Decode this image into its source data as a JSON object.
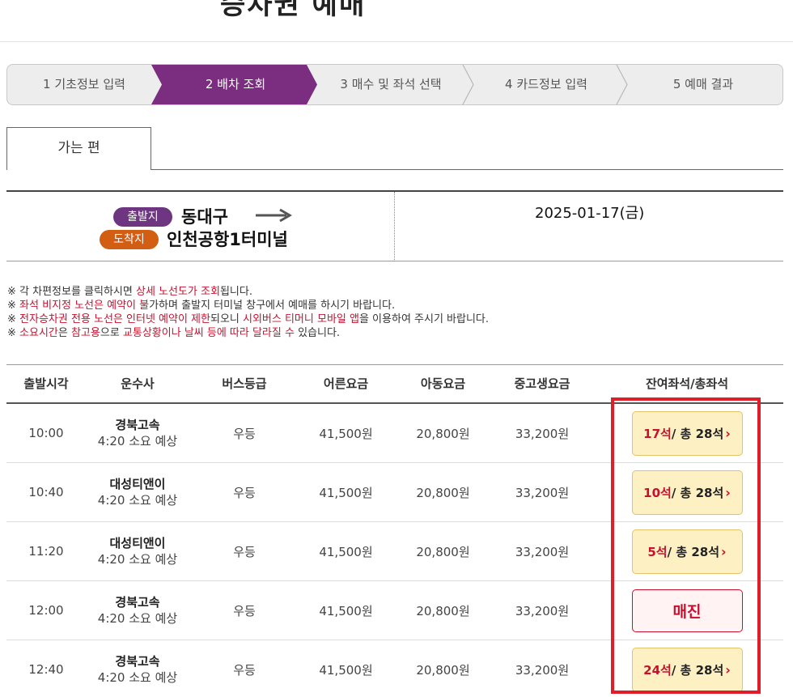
{
  "page": {
    "title": "승차권 예매"
  },
  "steps": [
    {
      "label": "1 기초정보 입력",
      "active": false
    },
    {
      "label": "2 배차 조회",
      "active": true
    },
    {
      "label": "3 매수 및 좌석 선택",
      "active": false
    },
    {
      "label": "4 카드정보 입력",
      "active": false
    },
    {
      "label": "5 예매 결과",
      "active": false
    }
  ],
  "tab": {
    "label": "가는 편"
  },
  "route": {
    "departure_badge": "출발지",
    "departure": "동대구",
    "arrival_badge": "도착지",
    "arrival": "인천공항1터미널",
    "date": "2025-01-17(금)"
  },
  "notices": [
    [
      {
        "t": "※ 각 차편정보를 클릭하시면 "
      },
      {
        "t": "상세 노선도가 조회",
        "hl": true
      },
      {
        "t": "됩니다."
      }
    ],
    [
      {
        "t": "※ "
      },
      {
        "t": "좌석 비지정 노선은 예약이 불",
        "hl": true
      },
      {
        "t": "가하며 출발지 터미널 창구에서 예매를 하시기 바랍니다."
      }
    ],
    [
      {
        "t": "※ "
      },
      {
        "t": "전자승차권 전용 노선은 인터넷 예약이 제한",
        "hl": true
      },
      {
        "t": "되오니 "
      },
      {
        "t": "시외버스 티머니 모바일 앱",
        "hl": true
      },
      {
        "t": "을 이용하여 주시기 바랍니다."
      }
    ],
    [
      {
        "t": "※ "
      },
      {
        "t": "소요시간",
        "hl": true
      },
      {
        "t": "은 "
      },
      {
        "t": "참고용",
        "hl": true
      },
      {
        "t": "으로 "
      },
      {
        "t": "교통상황이나 날씨 등에 따라 달라질 수",
        "hl": true
      },
      {
        "t": " 있습니다."
      }
    ]
  ],
  "table": {
    "headers": [
      "출발시각",
      "운수사",
      "버스등급",
      "어른요금",
      "아동요금",
      "중고생요금",
      "잔여좌석/총좌석"
    ],
    "rows": [
      {
        "time": "10:00",
        "company": "경북고속",
        "duration": "4:20 소요 예상",
        "grade": "우등",
        "adult": "41,500원",
        "child": "20,800원",
        "youth": "33,200원",
        "remaining": "17석",
        "total": " / 총 28석",
        "soldout": false
      },
      {
        "time": "10:40",
        "company": "대성티앤이",
        "duration": "4:20 소요 예상",
        "grade": "우등",
        "adult": "41,500원",
        "child": "20,800원",
        "youth": "33,200원",
        "remaining": "10석",
        "total": " / 총 28석",
        "soldout": false
      },
      {
        "time": "11:20",
        "company": "대성티앤이",
        "duration": "4:20 소요 예상",
        "grade": "우등",
        "adult": "41,500원",
        "child": "20,800원",
        "youth": "33,200원",
        "remaining": "5석",
        "total": " / 총 28석",
        "soldout": false
      },
      {
        "time": "12:00",
        "company": "경북고속",
        "duration": "4:20 소요 예상",
        "grade": "우등",
        "adult": "41,500원",
        "child": "20,800원",
        "youth": "33,200원",
        "soldout_label": "매진",
        "soldout": true
      },
      {
        "time": "12:40",
        "company": "경북고속",
        "duration": "4:20 소요 예상",
        "grade": "우등",
        "adult": "41,500원",
        "child": "20,800원",
        "youth": "33,200원",
        "remaining": "24석",
        "total": " / 총 28석",
        "soldout": false
      }
    ]
  },
  "colors": {
    "active_step": "#7b2d7f",
    "departure_badge": "#6e3580",
    "arrival_badge": "#d15e13",
    "highlight": "#e21d2a",
    "notice_red": "#c8102e"
  }
}
